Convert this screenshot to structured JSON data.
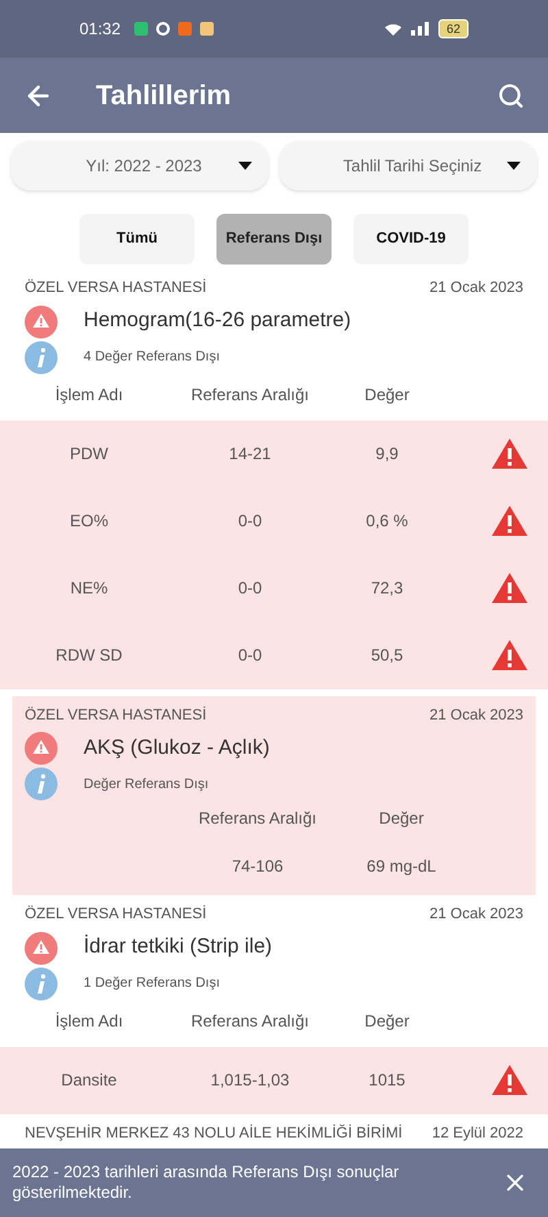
{
  "status_bar": {
    "time": "01:32",
    "battery": "62"
  },
  "app_bar": {
    "title": "Tahlillerim"
  },
  "dropdowns": [
    {
      "value": "Yıl: 2022 - 2023"
    },
    {
      "value": "Tahlil Tarihi Seçiniz"
    }
  ],
  "filters": [
    {
      "label": "Tümü",
      "selected": false
    },
    {
      "label": "Referans Dışı",
      "selected": true
    },
    {
      "label": "COVID-19",
      "selected": false
    }
  ],
  "results": [
    {
      "kind": "table",
      "hospital": "ÖZEL VERSA HASTANESİ",
      "date": "21 Ocak 2023",
      "title": "Hemogram(16-26 parametre)",
      "note": "4 Değer Referans Dışı",
      "columns": [
        "İşlem Adı",
        "Referans Aralığı",
        "Değer"
      ],
      "rows": [
        {
          "name": "PDW",
          "range": "14-21",
          "value": "9,9",
          "out_of_range": true
        },
        {
          "name": "EO%",
          "range": "0-0",
          "value": "0,6 %",
          "out_of_range": true
        },
        {
          "name": "NE%",
          "range": "0-0",
          "value": "72,3",
          "out_of_range": true
        },
        {
          "name": "RDW SD",
          "range": "0-0",
          "value": "50,5",
          "out_of_range": true
        }
      ]
    },
    {
      "kind": "single",
      "hospital": "ÖZEL VERSA HASTANESİ",
      "date": "21 Ocak 2023",
      "title": "AKŞ (Glukoz - Açlık)",
      "note": "Değer Referans Dışı",
      "columns": [
        "Referans Aralığı",
        "Değer"
      ],
      "rows": [
        {
          "range": "74-106",
          "value": "69 mg-dL",
          "out_of_range": false
        }
      ]
    },
    {
      "kind": "table",
      "hospital": "ÖZEL VERSA HASTANESİ",
      "date": "21 Ocak 2023",
      "title": "İdrar tetkiki (Strip ile)",
      "note": "1 Değer Referans Dışı",
      "columns": [
        "İşlem Adı",
        "Referans Aralığı",
        "Değer"
      ],
      "rows": [
        {
          "name": "Dansite",
          "range": "1,015-1,03",
          "value": "1015",
          "out_of_range": true
        }
      ]
    },
    {
      "kind": "partial",
      "hospital": "NEVŞEHİR MERKEZ 43 NOLU AİLE HEKİMLİĞİ BİRİMİ",
      "date": "12 Eylül 2022"
    }
  ],
  "snackbar": {
    "message": "2022 - 2023 tarihleri arasında Referans Dışı sonuçlar gösterilmektedir."
  }
}
